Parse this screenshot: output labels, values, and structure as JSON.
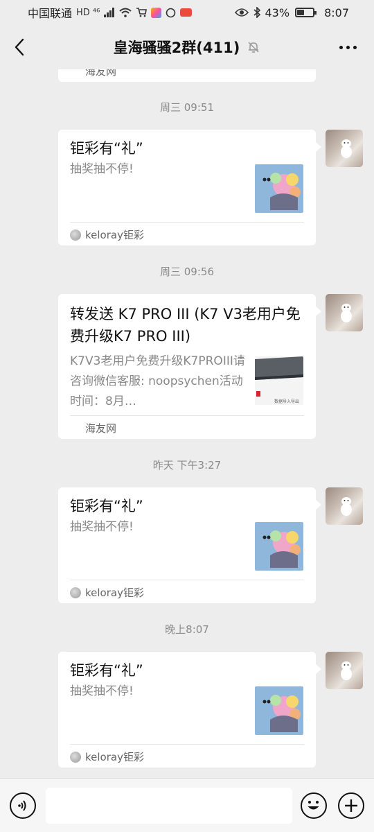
{
  "status_bar": {
    "carrier": "中国联通",
    "network_badges": "HD ⁴⁶",
    "battery": "43%",
    "time": "8:07"
  },
  "header": {
    "title": "皇海骚骚2群(411)"
  },
  "chat": {
    "partial_source": "海友网",
    "messages": [
      {
        "time": "周三 09:51",
        "title": "钜彩有“礼”",
        "desc": "抽奖抽不停!",
        "source": "keloray钜彩"
      },
      {
        "time": "周三 09:56",
        "title": "转发送 K7 PRO III (K7 V3老用户免费升级K7 PRO III)",
        "desc": "K7V3老用户免费升级K7PROIII请咨询微信客服: noopsychen活动时间：8月…",
        "source": "海友网",
        "thumb_text": "数据导入导出"
      },
      {
        "time": "昨天 下午3:27",
        "title": "钜彩有“礼”",
        "desc": "抽奖抽不停!",
        "source": "keloray钜彩"
      },
      {
        "time": "晚上8:07",
        "title": "钜彩有“礼”",
        "desc": "抽奖抽不停!",
        "source": "keloray钜彩"
      }
    ]
  },
  "input": {
    "placeholder": ""
  }
}
